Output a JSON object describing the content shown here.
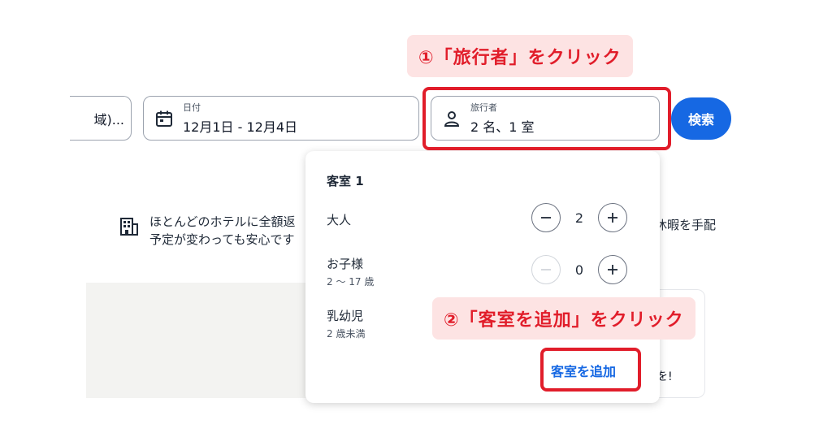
{
  "search": {
    "destination_value": "域)...",
    "date": {
      "label": "日付",
      "value": "12月1日 - 12月4日"
    },
    "travelers": {
      "label": "旅行者",
      "value": "2 名、1 室"
    },
    "search_button": "検索"
  },
  "annotations": {
    "step1": "①「旅行者」をクリック",
    "step2": "②「客室を追加」をクリック",
    "color": "#e11d2a",
    "bg_color": "#fde3e3"
  },
  "background": {
    "info_line1": "ほとんどのホテルに全額返",
    "info_line2": "予定が変わっても安心です",
    "right_text": "休暇を手配",
    "card_fragment": "を!"
  },
  "travelers_panel": {
    "room_title": "客室 1",
    "adults": {
      "label": "大人",
      "value": "2"
    },
    "children": {
      "label": "お子様",
      "sub": "2 ～ 17 歳",
      "value": "0"
    },
    "infants": {
      "label": "乳幼児",
      "sub": "2 歳未満"
    },
    "add_room": "客室を追加"
  },
  "icons": {
    "date": "calendar-icon",
    "travelers": "person-icon",
    "info": "building-icon",
    "minus": "minus-icon",
    "plus": "plus-icon"
  },
  "colors": {
    "accent": "#1668e3"
  }
}
